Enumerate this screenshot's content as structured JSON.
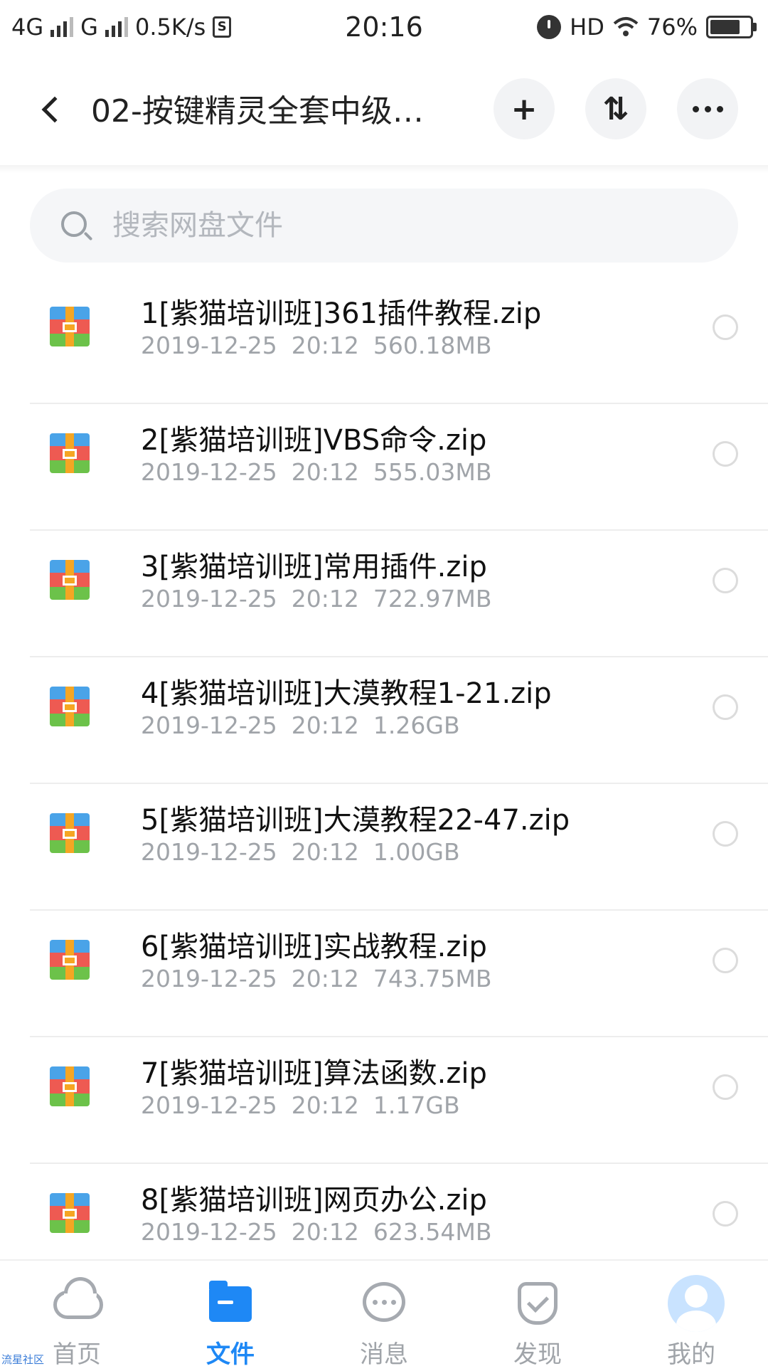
{
  "status_bar": {
    "network1": "4G",
    "network2": "G",
    "speed": "0.5K/s",
    "time": "20:16",
    "hd": "HD",
    "battery": "76%"
  },
  "header": {
    "title": "02-按键精灵全套中级…",
    "add_label": "+",
    "sort_label": "⇅"
  },
  "search": {
    "placeholder": "搜索网盘文件"
  },
  "files": [
    {
      "name": "1[紫猫培训班]361插件教程.zip",
      "date": "2019-12-25",
      "time": "20:12",
      "size": "560.18MB"
    },
    {
      "name": "2[紫猫培训班]VBS命令.zip",
      "date": "2019-12-25",
      "time": "20:12",
      "size": "555.03MB"
    },
    {
      "name": "3[紫猫培训班]常用插件.zip",
      "date": "2019-12-25",
      "time": "20:12",
      "size": "722.97MB"
    },
    {
      "name": "4[紫猫培训班]大漠教程1-21.zip",
      "date": "2019-12-25",
      "time": "20:12",
      "size": "1.26GB"
    },
    {
      "name": "5[紫猫培训班]大漠教程22-47.zip",
      "date": "2019-12-25",
      "time": "20:12",
      "size": "1.00GB"
    },
    {
      "name": "6[紫猫培训班]实战教程.zip",
      "date": "2019-12-25",
      "time": "20:12",
      "size": "743.75MB"
    },
    {
      "name": "7[紫猫培训班]算法函数.zip",
      "date": "2019-12-25",
      "time": "20:12",
      "size": "1.17GB"
    },
    {
      "name": "8[紫猫培训班]网页办公.zip",
      "date": "2019-12-25",
      "time": "20:12",
      "size": "623.54MB"
    }
  ],
  "bottom_nav": [
    {
      "label": "首页",
      "icon": "cloud-icon"
    },
    {
      "label": "文件",
      "icon": "folder-icon",
      "active": true
    },
    {
      "label": "消息",
      "icon": "message-icon"
    },
    {
      "label": "发现",
      "icon": "discover-icon"
    },
    {
      "label": "我的",
      "icon": "avatar-icon"
    }
  ],
  "watermark": "流星社区",
  "colors": {
    "accent": "#1e88f5",
    "muted": "#a0a4a9"
  }
}
